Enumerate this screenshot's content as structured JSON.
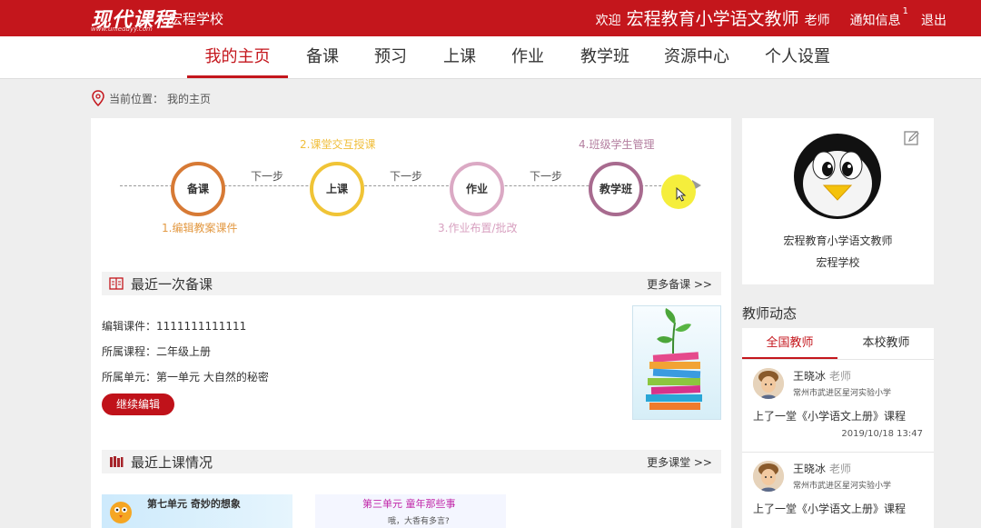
{
  "header": {
    "logo": "现代课程",
    "logo_sub": "www.unieduyy.com",
    "school": "宏程学校",
    "welcome": "欢迎",
    "user_name": "宏程教育小学语文教师",
    "role": "老师",
    "notice": "通知信息",
    "notice_count": "1",
    "logout": "退出"
  },
  "nav": {
    "items": [
      {
        "label": "我的主页",
        "active": true
      },
      {
        "label": "备课"
      },
      {
        "label": "预习"
      },
      {
        "label": "上课"
      },
      {
        "label": "作业"
      },
      {
        "label": "教学班"
      },
      {
        "label": "资源中心"
      },
      {
        "label": "个人设置"
      }
    ]
  },
  "breadcrumb": {
    "prefix": "当前位置：",
    "current": "我的主页"
  },
  "steps": {
    "circles": [
      {
        "label": "备课",
        "color": "#d77a35"
      },
      {
        "label": "上课",
        "color": "#f0c436"
      },
      {
        "label": "作业",
        "color": "#dba9c4"
      },
      {
        "label": "教学班",
        "color": "#a86b8f"
      }
    ],
    "next_label": "下一步",
    "labels": [
      {
        "text": "1.编辑教案课件",
        "color": "#e39a44"
      },
      {
        "text": "2.课堂交互授课",
        "color": "#f0be3a"
      },
      {
        "text": "3.作业布置/批改",
        "color": "#d8a1c0"
      },
      {
        "text": "4.班级学生管理",
        "color": "#b47fa0"
      }
    ]
  },
  "recent_prep": {
    "title": "最近一次备课",
    "more": "更多备课 >>",
    "courseware_label": "编辑课件：",
    "courseware_value": "1111111111111",
    "course_label": "所属课程：",
    "course_value": "二年级上册",
    "unit_label": "所属单元：",
    "unit_value": "第一单元 大自然的秘密",
    "button": "继续编辑"
  },
  "recent_class": {
    "title": "最近上课情况",
    "more": "更多课堂 >>",
    "thumb1_title": "第七单元 奇妙的想象",
    "thumb2_title": "第三单元 童年那些事",
    "thumb2_sub": "哦，大香有多言?"
  },
  "profile": {
    "name": "宏程教育小学语文教师",
    "school": "宏程学校"
  },
  "dynamics": {
    "title": "教师动态",
    "tabs": [
      {
        "label": "全国教师",
        "active": true
      },
      {
        "label": "本校教师"
      }
    ],
    "feed": [
      {
        "name": "王晓冰",
        "role": "老师",
        "location": "常州市武进区星河实验小学",
        "action": "上了一堂《小学语文上册》课程",
        "time": "2019/10/18 13:47"
      },
      {
        "name": "王晓冰",
        "role": "老师",
        "location": "常州市武进区星河实验小学",
        "action": "上了一堂《小学语文上册》课程",
        "time": ""
      }
    ]
  },
  "colors": {
    "brand_red": "#c4161c"
  }
}
